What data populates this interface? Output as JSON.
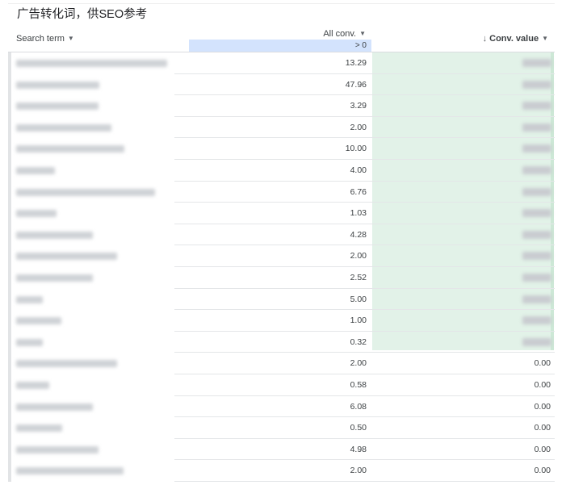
{
  "title": "广告转化词，供SEO参考",
  "columns": {
    "search_term": "Search term",
    "all_conv": "All conv.",
    "all_conv_filter": "> 0",
    "conv_value": "Conv. value",
    "sort_arrow": "↓",
    "dropdown_glyph": "▼"
  },
  "colors": {
    "filter_bg": "#d3e3fd",
    "highlight_green": "#e2f2e8",
    "blur_gray": "#cfd2d6"
  },
  "rows": [
    {
      "all_conv": "13.29",
      "conv_value": null
    },
    {
      "all_conv": "47.96",
      "conv_value": null
    },
    {
      "all_conv": "3.29",
      "conv_value": null
    },
    {
      "all_conv": "2.00",
      "conv_value": null
    },
    {
      "all_conv": "10.00",
      "conv_value": null
    },
    {
      "all_conv": "4.00",
      "conv_value": null
    },
    {
      "all_conv": "6.76",
      "conv_value": null
    },
    {
      "all_conv": "1.03",
      "conv_value": null
    },
    {
      "all_conv": "4.28",
      "conv_value": null
    },
    {
      "all_conv": "2.00",
      "conv_value": null
    },
    {
      "all_conv": "2.52",
      "conv_value": null
    },
    {
      "all_conv": "5.00",
      "conv_value": null
    },
    {
      "all_conv": "1.00",
      "conv_value": null
    },
    {
      "all_conv": "0.32",
      "conv_value": null
    },
    {
      "all_conv": "2.00",
      "conv_value": "0.00"
    },
    {
      "all_conv": "0.58",
      "conv_value": "0.00"
    },
    {
      "all_conv": "6.08",
      "conv_value": "0.00"
    },
    {
      "all_conv": "0.50",
      "conv_value": "0.00"
    },
    {
      "all_conv": "4.98",
      "conv_value": "0.00"
    },
    {
      "all_conv": "2.00",
      "conv_value": "0.00"
    }
  ]
}
